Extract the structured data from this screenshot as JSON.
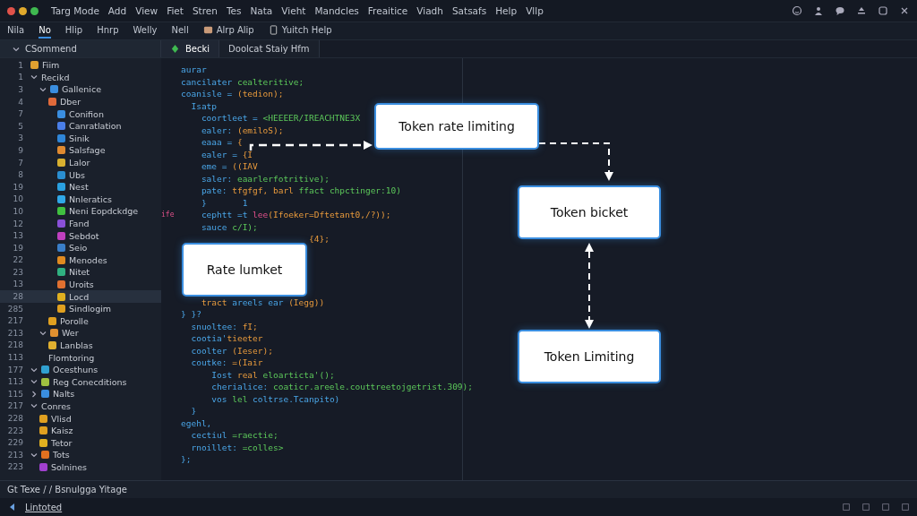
{
  "menu_bar": {
    "items": [
      "Targ Mode",
      "Add",
      "View",
      "Fiet",
      "Stren",
      "Tes",
      "Nata",
      "Vieht",
      "Mandcles",
      "Freaitice",
      "Viadh",
      "Satsafs",
      "Help",
      "Vllp"
    ]
  },
  "toolbar": {
    "items": [
      {
        "label": "Nila",
        "selected": false
      },
      {
        "label": "No",
        "selected": true
      },
      {
        "label": "Hlip",
        "selected": false
      },
      {
        "label": "Hnrp",
        "selected": false
      },
      {
        "label": "Welly",
        "selected": false
      },
      {
        "label": "Nell",
        "selected": false
      },
      {
        "label": "Alrp Alip",
        "selected": false,
        "kind": "box"
      },
      {
        "label": "Yuitch Help",
        "selected": false,
        "kind": "doc"
      }
    ]
  },
  "sidebar": {
    "title": "CSommend",
    "tree": [
      {
        "line": "1",
        "label": "Fiim",
        "color": "#e0a030",
        "selected": false
      },
      {
        "line": "1",
        "label": "Recikd",
        "selected": false,
        "expanded": true,
        "children": [
          {
            "line": "3",
            "label": "Gallenice",
            "color": "#3a8ee0",
            "selected": false,
            "expanded": true,
            "children": [
              {
                "line": "4",
                "label": "Dber",
                "color": "#e06a3a",
                "selected": false,
                "children": [
                  {
                    "line": "7",
                    "label": "Conifion",
                    "color": "#3a8ee0",
                    "selected": false
                  },
                  {
                    "line": "5",
                    "label": "Canratlation",
                    "color": "#4a7ee8",
                    "selected": false
                  },
                  {
                    "line": "3",
                    "label": "Sinik",
                    "color": "#2f86d8",
                    "selected": false
                  },
                  {
                    "line": "9",
                    "label": "Salsfage",
                    "color": "#e08a30",
                    "selected": false
                  },
                  {
                    "line": "7",
                    "label": "Lalor",
                    "color": "#d8b030",
                    "selected": false
                  },
                  {
                    "line": "8",
                    "label": "Ubs",
                    "color": "#2a8ed0",
                    "selected": false
                  },
                  {
                    "line": "19",
                    "label": "Nest",
                    "color": "#2aa0e0",
                    "selected": false
                  },
                  {
                    "line": "10",
                    "label": "Nnleratics",
                    "color": "#30a8e8",
                    "selected": false
                  },
                  {
                    "line": "10",
                    "label": "Neni Eopdckdge",
                    "color": "#40c040",
                    "selected": false
                  },
                  {
                    "line": "12",
                    "label": "Fand",
                    "color": "#8a50d8",
                    "selected": false
                  },
                  {
                    "line": "13",
                    "label": "Sebdot",
                    "color": "#c040c0",
                    "selected": false
                  },
                  {
                    "line": "19",
                    "label": "Seio",
                    "color": "#3a7ec8",
                    "selected": false
                  },
                  {
                    "line": "22",
                    "label": "Menodes",
                    "color": "#e08a20",
                    "selected": false
                  },
                  {
                    "line": "23",
                    "label": "Nitet",
                    "color": "#30b080",
                    "selected": false
                  },
                  {
                    "line": "13",
                    "label": "Uroits",
                    "color": "#e07030",
                    "selected": false
                  },
                  {
                    "line": "28",
                    "label": "Locd",
                    "color": "#e0b020",
                    "selected": true
                  },
                  {
                    "line": "285",
                    "label": "Sindlogim",
                    "color": "#e0a020",
                    "selected": false
                  }
                ]
              },
              {
                "line": "217",
                "label": "Porolle",
                "color": "#e0a020",
                "selected": false
              }
            ]
          },
          {
            "line": "213",
            "label": "Wer",
            "color": "#e09030",
            "selected": false,
            "expanded": true,
            "children": [
              {
                "line": "218",
                "label": "Lanblas",
                "color": "#e0b030",
                "selected": false
              },
              {
                "line": "113",
                "label": "Flomtoring",
                "selected": false
              }
            ]
          }
        ]
      },
      {
        "line": "177",
        "label": "Ocesthuns",
        "color": "#30a0d0",
        "selected": false,
        "expanded": true
      },
      {
        "line": "113",
        "label": "Reg Conecditions",
        "color": "#a0c040",
        "selected": false,
        "expanded": true
      },
      {
        "line": "115",
        "label": "Nalts",
        "color": "#3a8ee0",
        "selected": false,
        "expanded": false
      },
      {
        "line": "217",
        "label": "Conres",
        "selected": false,
        "expanded": true,
        "children": [
          {
            "line": "228",
            "label": "Vlisd",
            "color": "#e0a020",
            "selected": false
          },
          {
            "line": "223",
            "label": "Kaisz",
            "color": "#e0a020",
            "selected": false
          },
          {
            "line": "229",
            "label": "Tetor",
            "color": "#e0b020",
            "selected": false
          }
        ]
      },
      {
        "line": "213",
        "label": "Tots",
        "color": "#e07020",
        "selected": false,
        "expanded": true,
        "children": [
          {
            "line": "223",
            "label": "Solnines",
            "color": "#a040d0",
            "selected": false
          }
        ]
      }
    ]
  },
  "editor_tabs": [
    {
      "label": "Becki",
      "selected": true
    },
    {
      "label": "Doolcat Staiy Hfm",
      "selected": false
    }
  ],
  "code": [
    [
      {
        "text": "aurar",
        "kind": "id"
      }
    ],
    [
      {
        "text": "cancilater ",
        "kind": "id"
      },
      {
        "text": "cealteritive;",
        "kind": "str"
      }
    ],
    [
      {
        "text": "coanisle = ",
        "kind": "id"
      },
      {
        "text": "(tedion);",
        "kind": "num"
      }
    ],
    [
      {
        "text": "  Isatp",
        "kind": "id"
      }
    ],
    [
      {
        "text": "    coortleet = ",
        "kind": "id"
      },
      {
        "text": "<HEEEER/IREACHTNE3X",
        "kind": "str"
      }
    ],
    [
      {
        "text": "    ealer: ",
        "kind": "id"
      },
      {
        "text": "(emiloS);",
        "kind": "num"
      }
    ],
    [
      {
        "text": "    eaaa = ",
        "kind": "id"
      },
      {
        "text": "{",
        "kind": "num"
      }
    ],
    [
      {
        "text": "    ealer = ",
        "kind": "id"
      },
      {
        "text": "{I",
        "kind": "num"
      }
    ],
    [
      {
        "text": "    eme = ",
        "kind": "id"
      },
      {
        "text": "((IAV",
        "kind": "num"
      }
    ],
    [
      {
        "text": "    saler: ",
        "kind": "id"
      },
      {
        "text": "eaarlerfotritive);",
        "kind": "str"
      }
    ],
    [
      {
        "text": "    pate: ",
        "kind": "id"
      },
      {
        "text": "tfgfgf, barl ",
        "kind": "num"
      },
      {
        "text": "ffact chpctinger:10)",
        "kind": "str"
      }
    ],
    [
      {
        "text": "    }       1",
        "kind": "id"
      }
    ],
    [
      {
        "text": "ife",
        "kind": "mark"
      },
      {
        "text": "    cephtt =t ",
        "kind": "id"
      },
      {
        "text": "lee",
        "kind": "kw"
      },
      {
        "text": "(Ifoeker=Dftetant0,/?));",
        "kind": "num"
      }
    ],
    [
      {
        "text": "    sauce ",
        "kind": "id"
      },
      {
        "text": "c/I);",
        "kind": "str"
      }
    ],
    [
      {
        "text": "                         {4};",
        "kind": "num"
      }
    ],
    [
      {
        "text": "    tract ",
        "kind": "num"
      },
      {
        "text": "areels ear ",
        "kind": "id"
      },
      {
        "text": "(Iegg))",
        "kind": "num"
      }
    ],
    [
      {
        "text": "} }?",
        "kind": "id"
      }
    ],
    [
      {
        "text": "  snuoltee: ",
        "kind": "id"
      },
      {
        "text": "fI;",
        "kind": "num"
      }
    ],
    [
      {
        "text": "  cootia'",
        "kind": "id"
      },
      {
        "text": "tieeter",
        "kind": "num"
      }
    ],
    [
      {
        "text": "  coolter ",
        "kind": "id"
      },
      {
        "text": "(Ieser);",
        "kind": "num"
      }
    ],
    [
      {
        "text": "  coutke: ",
        "kind": "id"
      },
      {
        "text": "=(Iair",
        "kind": "num"
      }
    ],
    [
      {
        "text": "      Iost ",
        "kind": "id"
      },
      {
        "text": "real ",
        "kind": "num"
      },
      {
        "text": "eloarticta'();",
        "kind": "str"
      }
    ],
    [
      {
        "text": "      cherialice: ",
        "kind": "id"
      },
      {
        "text": "coaticr.areele.couttreetojgetrist.309);",
        "kind": "str"
      }
    ],
    [
      {
        "text": "      vos ",
        "kind": "id"
      },
      {
        "text": "lel ",
        "kind": "str"
      },
      {
        "text": "coltrse.Tcanpito)",
        "kind": "id"
      }
    ],
    [
      {
        "text": "  }",
        "kind": "id"
      }
    ],
    [
      {
        "text": "egehl,",
        "kind": "id"
      }
    ],
    [
      {
        "text": "  cectiul ",
        "kind": "id"
      },
      {
        "text": "=raectie;",
        "kind": "str"
      }
    ],
    [
      {
        "text": "  rnoillet: ",
        "kind": "id"
      },
      {
        "text": "=colles>",
        "kind": "str"
      }
    ],
    [
      {
        "text": "};",
        "kind": "id"
      }
    ]
  ],
  "diagram": {
    "nodes": [
      {
        "label": "Token rate limiting"
      },
      {
        "label": "Token bicket"
      },
      {
        "label": "Token Limiting"
      },
      {
        "label": "Rate lumket"
      }
    ]
  },
  "status_bar": {
    "text": "Gt Texe / / Bsnulgga Yitage"
  },
  "bottom_bar": {
    "text": "Lintoted"
  }
}
